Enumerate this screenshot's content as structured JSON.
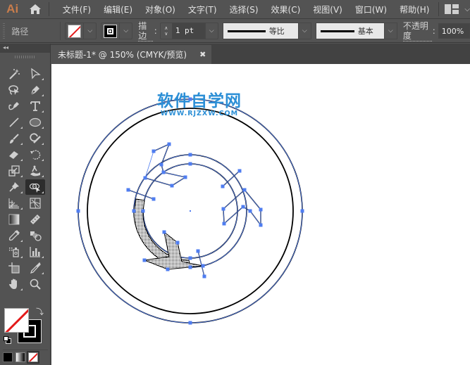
{
  "app": {
    "logo": "Ai",
    "menu": [
      "文件(F)",
      "编辑(E)",
      "对象(O)",
      "文字(T)",
      "选择(S)",
      "效果(C)",
      "视图(V)",
      "窗口(W)",
      "帮助(H)"
    ]
  },
  "control_bar": {
    "selection_type": "路径",
    "stroke_label": "描边",
    "stroke_weight": "1 pt",
    "variable_width_profile": "等比",
    "brush_definition": "基本",
    "opacity_label": "不透明度",
    "opacity_value": "100%",
    "fill": "none",
    "stroke_color": "#000000"
  },
  "document_tab": {
    "title": "未标题-1* @ 150% (CMYK/预览)",
    "close": "✖"
  },
  "toolbar": {
    "collapse": "◂◂",
    "tools": [
      {
        "name": "magic-wand-tool",
        "has_submenu": false
      },
      {
        "name": "direct-selection-tool",
        "has_submenu": true
      },
      {
        "name": "lasso-tool",
        "has_submenu": false
      },
      {
        "name": "pen-tool",
        "has_submenu": true
      },
      {
        "name": "curvature-tool",
        "has_submenu": false
      },
      {
        "name": "type-tool",
        "has_submenu": true
      },
      {
        "name": "line-segment-tool",
        "has_submenu": true
      },
      {
        "name": "ellipse-tool",
        "has_submenu": true
      },
      {
        "name": "paintbrush-tool",
        "has_submenu": true
      },
      {
        "name": "shaper-tool",
        "has_submenu": true
      },
      {
        "name": "eraser-tool",
        "has_submenu": true
      },
      {
        "name": "rotate-tool",
        "has_submenu": true
      },
      {
        "name": "scale-tool",
        "has_submenu": true
      },
      {
        "name": "puppet-warp-tool",
        "has_submenu": true
      },
      {
        "name": "pin-tool",
        "has_submenu": true
      },
      {
        "name": "shape-builder-tool",
        "has_submenu": true,
        "active": true
      },
      {
        "name": "perspective-grid-tool",
        "has_submenu": true
      },
      {
        "name": "mesh-tool",
        "has_submenu": false
      },
      {
        "name": "gradient-tool",
        "has_submenu": false
      },
      {
        "name": "measure-tool",
        "has_submenu": false
      },
      {
        "name": "eyedropper-tool",
        "has_submenu": true
      },
      {
        "name": "blend-tool",
        "has_submenu": false
      },
      {
        "name": "symbol-sprayer-tool",
        "has_submenu": true
      },
      {
        "name": "column-graph-tool",
        "has_submenu": true
      },
      {
        "name": "artboard-tool",
        "has_submenu": false
      },
      {
        "name": "slice-tool",
        "has_submenu": true
      },
      {
        "name": "hand-tool",
        "has_submenu": true
      },
      {
        "name": "zoom-tool",
        "has_submenu": false
      }
    ],
    "fill_color": "none",
    "stroke_color": "#000000",
    "swap_icon": "⤵"
  },
  "canvas": {
    "watermark_title": "软件自学网",
    "watermark_url": "WWW.RJZXW.COM",
    "selection_color": "#4f7df0"
  }
}
